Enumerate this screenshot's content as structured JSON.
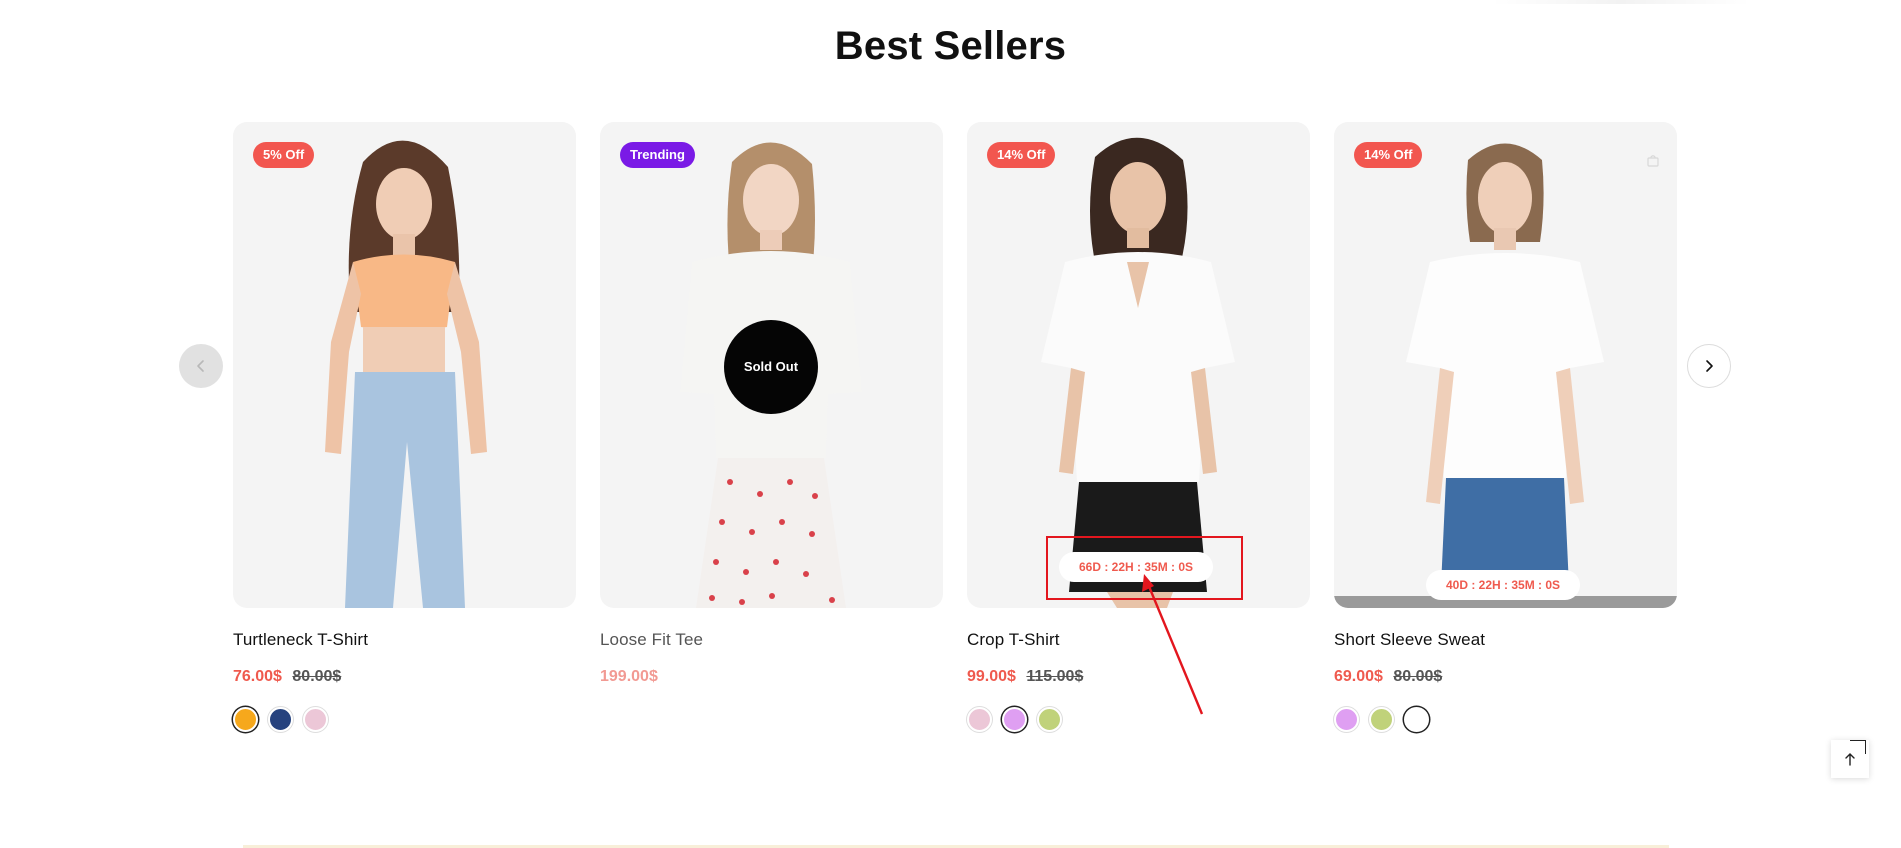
{
  "section": {
    "title": "Best Sellers"
  },
  "carousel": {
    "prev_icon": "chevron-left-icon",
    "next_icon": "chevron-right-icon",
    "products": [
      {
        "name": "Turtleneck T-Shirt",
        "badge": "5% Off",
        "badge_type": "sale",
        "price": "76.00$",
        "old_price": "80.00$",
        "swatches": [
          {
            "color": "#f6a81c",
            "selected": true
          },
          {
            "color": "#26427e",
            "selected": false
          },
          {
            "color": "#ecc7d7",
            "selected": false
          }
        ],
        "top_color": "#f8b886",
        "bottom_color": "#a9c4df"
      },
      {
        "name": "Loose Fit Tee",
        "badge": "Trending",
        "badge_type": "trend",
        "price": "199.00$",
        "sold_out_label": "Sold Out",
        "top_color": "#f5f5f3",
        "bottom_color": "#f3f0ee"
      },
      {
        "name": "Crop T-Shirt",
        "badge": "14% Off",
        "badge_type": "sale",
        "price": "99.00$",
        "old_price": "115.00$",
        "countdown": "66D : 22H : 35M : 0S",
        "swatches": [
          {
            "color": "#ecc7d7",
            "selected": false
          },
          {
            "color": "#df9ff2",
            "selected": true
          },
          {
            "color": "#c0d27a",
            "selected": false
          }
        ],
        "top_color": "#fbfbfb",
        "bottom_color": "#1a1a1a"
      },
      {
        "name": "Short Sleeve Sweat",
        "badge": "14% Off",
        "badge_type": "sale",
        "price": "69.00$",
        "old_price": "80.00$",
        "countdown": "40D : 22H : 35M : 0S",
        "swatches": [
          {
            "color": "#df9ff2",
            "selected": false
          },
          {
            "color": "#c0d27a",
            "selected": false
          },
          {
            "color": "#ffffff",
            "selected": true
          }
        ],
        "top_color": "#fdfdfd",
        "bottom_color": "#3f6ea5",
        "icon": "bag-icon"
      }
    ]
  },
  "scroll_top": {
    "icon": "arrow-up-icon"
  },
  "annotation": {
    "color": "#e3161e"
  }
}
